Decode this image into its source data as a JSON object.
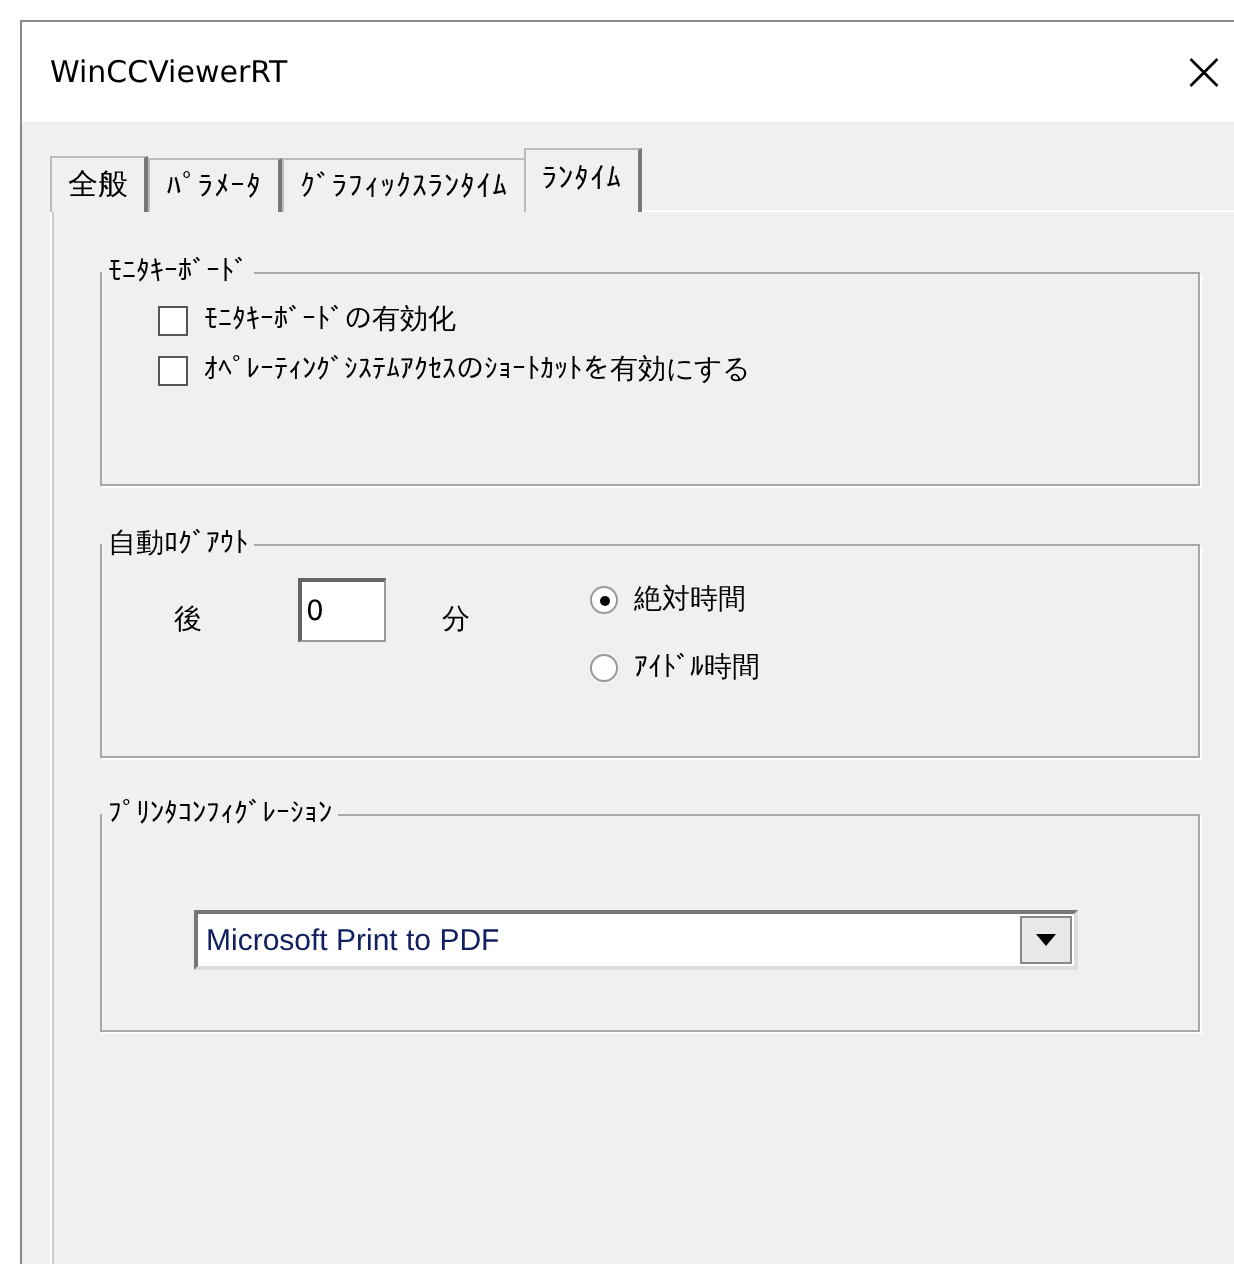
{
  "window": {
    "title": "WinCCViewerRT",
    "close": "×"
  },
  "tabs": [
    {
      "label": "全般",
      "selected": false
    },
    {
      "label": "ﾊﾟﾗﾒｰﾀ",
      "selected": false
    },
    {
      "label": "ｸﾞﾗﾌｨｯｸｽﾗﾝﾀｲﾑ",
      "selected": false
    },
    {
      "label": "ﾗﾝﾀｲﾑ",
      "selected": true
    }
  ],
  "monitor_keyboard": {
    "title": "ﾓﾆﾀｷｰﾎﾞｰﾄﾞ",
    "options": [
      {
        "label": "ﾓﾆﾀｷｰﾎﾞｰﾄﾞの有効化",
        "checked": false
      },
      {
        "label": "ｵﾍﾟﾚｰﾃｨﾝｸﾞｼｽﾃﾑｱｸｾｽのｼｮｰﾄｶｯﾄを有効にする",
        "checked": false
      }
    ]
  },
  "auto_logout": {
    "title": "自動ﾛｸﾞｱｳﾄ",
    "prefix": "後",
    "value": "0",
    "unit": "分",
    "modes": [
      {
        "label": "絶対時間",
        "selected": true
      },
      {
        "label": "ｱｲﾄﾞﾙ時間",
        "selected": false
      }
    ]
  },
  "printer": {
    "title": "ﾌﾟﾘﾝﾀｺﾝﾌｨｸﾞﾚｰｼｮﾝ",
    "value": "Microsoft Print to PDF"
  }
}
